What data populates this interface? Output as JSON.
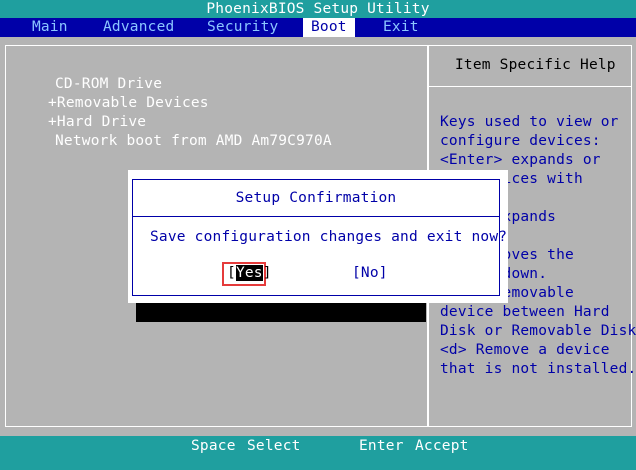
{
  "app": {
    "title": "PhoenixBIOS Setup Utility"
  },
  "menu": [
    "Main",
    "Advanced",
    "Security",
    "Boot",
    "Exit"
  ],
  "boot_list": [
    "CD-ROM Drive",
    "+Removable Devices",
    "+Hard Drive",
    "Network boot from AMD Am79C970A"
  ],
  "help": {
    "title": "Item Specific Help",
    "lines": [
      "Keys used to view or",
      "configure devices:",
      "<Enter> expands or",
      "  s devices with",
      "",
      "  er> expands",
      "",
      "  <-> moves the",
      "  p or down.",
      "  ove removable",
      "device between Hard",
      "Disk or Removable Disk",
      "<d> Remove a device",
      "that is not installed."
    ]
  },
  "dialog": {
    "title": "Setup Confirmation",
    "message": "Save configuration changes and exit now?",
    "yes_prefix": "[",
    "yes_highlight": "Yes",
    "yes_suffix": "]",
    "no_label": "[No]"
  },
  "status": {
    "space_key": "Space",
    "space_action": "Select",
    "enter_key": "Enter",
    "enter_action": "Accept"
  },
  "colors": {
    "background": "#b4b4b4",
    "menubar": "#0000a8",
    "titlebar": "#1f9f9f",
    "highlight_border": "#e53b3b"
  }
}
